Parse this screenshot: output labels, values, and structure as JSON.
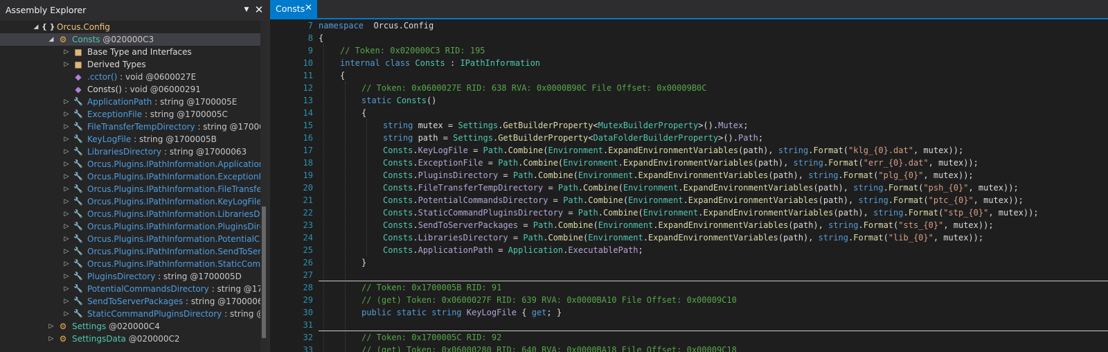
{
  "panel": {
    "title": "Assembly Explorer",
    "dropdown_icon": "chevron-down-icon",
    "close_icon": "close-icon"
  },
  "tree": [
    {
      "depth": 3,
      "expander": "expanded",
      "icon": "namespace-icon",
      "name": "Orcus.Config",
      "suffix": "",
      "kind": "namespace"
    },
    {
      "depth": 4,
      "expander": "expanded",
      "icon": "class-icon",
      "name": "Consts",
      "suffix": " @020000C3",
      "kind": "type",
      "selected": true
    },
    {
      "depth": 5,
      "expander": "collapsed",
      "icon": "folder-icon",
      "name": "Base Type and Interfaces",
      "suffix": "",
      "kind": "folder"
    },
    {
      "depth": 5,
      "expander": "collapsed",
      "icon": "folder-icon",
      "name": "Derived Types",
      "suffix": "",
      "kind": "folder"
    },
    {
      "depth": 5,
      "expander": "none",
      "icon": "method-icon",
      "name": ".cctor()",
      "suffix": " : void @0600027E",
      "kind": "member"
    },
    {
      "depth": 5,
      "expander": "none",
      "icon": "method-icon",
      "name": "Consts()",
      "suffix": " : void @06000291",
      "kind": "ctor"
    },
    {
      "depth": 5,
      "expander": "collapsed",
      "icon": "property-icon",
      "name": "ApplicationPath",
      "suffix": " : string @1700005E",
      "kind": "member"
    },
    {
      "depth": 5,
      "expander": "collapsed",
      "icon": "property-icon",
      "name": "ExceptionFile",
      "suffix": " : string @1700005C",
      "kind": "member"
    },
    {
      "depth": 5,
      "expander": "collapsed",
      "icon": "property-icon",
      "name": "FileTransferTempDirectory",
      "suffix": " : string @17000",
      "kind": "member"
    },
    {
      "depth": 5,
      "expander": "collapsed",
      "icon": "property-icon",
      "name": "KeyLogFile",
      "suffix": " : string @1700005B",
      "kind": "member"
    },
    {
      "depth": 5,
      "expander": "collapsed",
      "icon": "property-icon",
      "name": "LibrariesDirectory",
      "suffix": " : string @17000063",
      "kind": "member"
    },
    {
      "depth": 5,
      "expander": "collapsed",
      "icon": "property-icon",
      "name": "Orcus.Plugins.IPathInformation.Application",
      "suffix": "",
      "kind": "member"
    },
    {
      "depth": 5,
      "expander": "collapsed",
      "icon": "property-icon",
      "name": "Orcus.Plugins.IPathInformation.ExceptionF",
      "suffix": "",
      "kind": "member"
    },
    {
      "depth": 5,
      "expander": "collapsed",
      "icon": "property-icon",
      "name": "Orcus.Plugins.IPathInformation.FileTransfe",
      "suffix": "",
      "kind": "member"
    },
    {
      "depth": 5,
      "expander": "collapsed",
      "icon": "property-icon",
      "name": "Orcus.Plugins.IPathInformation.KeyLogFile",
      "suffix": "",
      "kind": "member"
    },
    {
      "depth": 5,
      "expander": "collapsed",
      "icon": "property-icon",
      "name": "Orcus.Plugins.IPathInformation.LibrariesDi",
      "suffix": "",
      "kind": "member"
    },
    {
      "depth": 5,
      "expander": "collapsed",
      "icon": "property-icon",
      "name": "Orcus.Plugins.IPathInformation.PluginsDire",
      "suffix": "",
      "kind": "member"
    },
    {
      "depth": 5,
      "expander": "collapsed",
      "icon": "property-icon",
      "name": "Orcus.Plugins.IPathInformation.PotentialCo",
      "suffix": "",
      "kind": "member"
    },
    {
      "depth": 5,
      "expander": "collapsed",
      "icon": "property-icon",
      "name": "Orcus.Plugins.IPathInformation.SendToSer",
      "suffix": "",
      "kind": "member"
    },
    {
      "depth": 5,
      "expander": "collapsed",
      "icon": "property-icon",
      "name": "Orcus.Plugins.IPathInformation.StaticComr",
      "suffix": "",
      "kind": "member"
    },
    {
      "depth": 5,
      "expander": "collapsed",
      "icon": "property-icon",
      "name": "PluginsDirectory",
      "suffix": " : string @1700005D",
      "kind": "member"
    },
    {
      "depth": 5,
      "expander": "collapsed",
      "icon": "property-icon",
      "name": "PotentialCommandsDirectory",
      "suffix": " : string @17",
      "kind": "member"
    },
    {
      "depth": 5,
      "expander": "collapsed",
      "icon": "property-icon",
      "name": "SendToServerPackages",
      "suffix": " : string @1700006",
      "kind": "member"
    },
    {
      "depth": 5,
      "expander": "collapsed",
      "icon": "property-icon",
      "name": "StaticCommandPluginsDirectory",
      "suffix": " : string @",
      "kind": "member"
    },
    {
      "depth": 4,
      "expander": "collapsed",
      "icon": "class-icon",
      "name": "Settings",
      "suffix": " @020000C4",
      "kind": "type"
    },
    {
      "depth": 4,
      "expander": "collapsed",
      "icon": "class-icon",
      "name": "SettingsData",
      "suffix": " @020000C2",
      "kind": "type"
    }
  ],
  "editor": {
    "tab_label": "Consts",
    "tab_close_icon": "close-icon"
  },
  "code_lines": [
    {
      "n": "7",
      "indent": 0,
      "tokens": [
        [
          "kw",
          "namespace"
        ],
        [
          "",
          "  "
        ],
        [
          "",
          "Orcus.Config"
        ]
      ]
    },
    {
      "n": "8",
      "indent": 0,
      "tokens": [
        [
          "",
          "{"
        ]
      ]
    },
    {
      "n": "9",
      "indent": 1,
      "tokens": [
        [
          "cm",
          "// Token: 0x020000C3 RID: 195"
        ]
      ]
    },
    {
      "n": "10",
      "indent": 1,
      "tokens": [
        [
          "kw",
          "internal"
        ],
        [
          "",
          " "
        ],
        [
          "kw",
          "class"
        ],
        [
          "",
          " "
        ],
        [
          "ty",
          "Consts"
        ],
        [
          "",
          " : "
        ],
        [
          "ty",
          "IPathInformation"
        ]
      ]
    },
    {
      "n": "11",
      "indent": 1,
      "tokens": [
        [
          "",
          "{"
        ]
      ]
    },
    {
      "n": "12",
      "indent": 2,
      "tokens": [
        [
          "cm",
          "// Token: 0x0600027E RID: 638 RVA: 0x0000B90C File Offset: 0x00009B0C"
        ]
      ]
    },
    {
      "n": "13",
      "indent": 2,
      "tokens": [
        [
          "kw",
          "static"
        ],
        [
          "",
          " "
        ],
        [
          "ty",
          "Consts"
        ],
        [
          "",
          "()"
        ]
      ]
    },
    {
      "n": "14",
      "indent": 2,
      "tokens": [
        [
          "",
          "{"
        ]
      ]
    },
    {
      "n": "15",
      "indent": 3,
      "tokens": [
        [
          "kw",
          "string"
        ],
        [
          "",
          " mutex = "
        ],
        [
          "ty",
          "Settings"
        ],
        [
          "",
          "."
        ],
        [
          "me",
          "GetBuilderProperty"
        ],
        [
          "",
          "<"
        ],
        [
          "ty",
          "MutexBuilderProperty"
        ],
        [
          "",
          ">()."
        ],
        [
          "mp",
          "Mutex"
        ],
        [
          "",
          ";"
        ]
      ]
    },
    {
      "n": "16",
      "indent": 3,
      "tokens": [
        [
          "kw",
          "string"
        ],
        [
          "",
          " path = "
        ],
        [
          "ty",
          "Settings"
        ],
        [
          "",
          "."
        ],
        [
          "me",
          "GetBuilderProperty"
        ],
        [
          "",
          "<"
        ],
        [
          "ty",
          "DataFolderBuilderProperty"
        ],
        [
          "",
          ">()."
        ],
        [
          "mp",
          "Path"
        ],
        [
          "",
          ";"
        ]
      ]
    },
    {
      "n": "17",
      "indent": 3,
      "tokens": [
        [
          "ty",
          "Consts"
        ],
        [
          "",
          "."
        ],
        [
          "mp",
          "KeyLogFile"
        ],
        [
          "",
          " = "
        ],
        [
          "ty",
          "Path"
        ],
        [
          "",
          "."
        ],
        [
          "me",
          "Combine"
        ],
        [
          "",
          "("
        ],
        [
          "ty",
          "Environment"
        ],
        [
          "",
          "."
        ],
        [
          "me",
          "ExpandEnvironmentVariables"
        ],
        [
          "",
          "(path), "
        ],
        [
          "kw",
          "string"
        ],
        [
          "",
          "."
        ],
        [
          "me",
          "Format"
        ],
        [
          "",
          "("
        ],
        [
          "st",
          "\"klg_{0}.dat\""
        ],
        [
          "",
          ", mutex));"
        ]
      ]
    },
    {
      "n": "18",
      "indent": 3,
      "tokens": [
        [
          "ty",
          "Consts"
        ],
        [
          "",
          "."
        ],
        [
          "mp",
          "ExceptionFile"
        ],
        [
          "",
          " = "
        ],
        [
          "ty",
          "Path"
        ],
        [
          "",
          "."
        ],
        [
          "me",
          "Combine"
        ],
        [
          "",
          "("
        ],
        [
          "ty",
          "Environment"
        ],
        [
          "",
          "."
        ],
        [
          "me",
          "ExpandEnvironmentVariables"
        ],
        [
          "",
          "(path), "
        ],
        [
          "kw",
          "string"
        ],
        [
          "",
          "."
        ],
        [
          "me",
          "Format"
        ],
        [
          "",
          "("
        ],
        [
          "st",
          "\"err_{0}.dat\""
        ],
        [
          "",
          ", mutex));"
        ]
      ]
    },
    {
      "n": "19",
      "indent": 3,
      "tokens": [
        [
          "ty",
          "Consts"
        ],
        [
          "",
          "."
        ],
        [
          "mp",
          "PluginsDirectory"
        ],
        [
          "",
          " = "
        ],
        [
          "ty",
          "Path"
        ],
        [
          "",
          "."
        ],
        [
          "me",
          "Combine"
        ],
        [
          "",
          "("
        ],
        [
          "ty",
          "Environment"
        ],
        [
          "",
          "."
        ],
        [
          "me",
          "ExpandEnvironmentVariables"
        ],
        [
          "",
          "(path), "
        ],
        [
          "kw",
          "string"
        ],
        [
          "",
          "."
        ],
        [
          "me",
          "Format"
        ],
        [
          "",
          "("
        ],
        [
          "st",
          "\"plg_{0}\""
        ],
        [
          "",
          ", mutex));"
        ]
      ]
    },
    {
      "n": "20",
      "indent": 3,
      "tokens": [
        [
          "ty",
          "Consts"
        ],
        [
          "",
          "."
        ],
        [
          "mp",
          "FileTransferTempDirectory"
        ],
        [
          "",
          " = "
        ],
        [
          "ty",
          "Path"
        ],
        [
          "",
          "."
        ],
        [
          "me",
          "Combine"
        ],
        [
          "",
          "("
        ],
        [
          "ty",
          "Environment"
        ],
        [
          "",
          "."
        ],
        [
          "me",
          "ExpandEnvironmentVariables"
        ],
        [
          "",
          "(path), "
        ],
        [
          "kw",
          "string"
        ],
        [
          "",
          "."
        ],
        [
          "me",
          "Format"
        ],
        [
          "",
          "("
        ],
        [
          "st",
          "\"psh_{0}\""
        ],
        [
          "",
          ", mutex));"
        ]
      ]
    },
    {
      "n": "21",
      "indent": 3,
      "tokens": [
        [
          "ty",
          "Consts"
        ],
        [
          "",
          "."
        ],
        [
          "mp",
          "PotentialCommandsDirectory"
        ],
        [
          "",
          " = "
        ],
        [
          "ty",
          "Path"
        ],
        [
          "",
          "."
        ],
        [
          "me",
          "Combine"
        ],
        [
          "",
          "("
        ],
        [
          "ty",
          "Environment"
        ],
        [
          "",
          "."
        ],
        [
          "me",
          "ExpandEnvironmentVariables"
        ],
        [
          "",
          "(path), "
        ],
        [
          "kw",
          "string"
        ],
        [
          "",
          "."
        ],
        [
          "me",
          "Format"
        ],
        [
          "",
          "("
        ],
        [
          "st",
          "\"ptc_{0}\""
        ],
        [
          "",
          ", mutex));"
        ]
      ]
    },
    {
      "n": "22",
      "indent": 3,
      "tokens": [
        [
          "ty",
          "Consts"
        ],
        [
          "",
          "."
        ],
        [
          "mp",
          "StaticCommandPluginsDirectory"
        ],
        [
          "",
          " = "
        ],
        [
          "ty",
          "Path"
        ],
        [
          "",
          "."
        ],
        [
          "me",
          "Combine"
        ],
        [
          "",
          "("
        ],
        [
          "ty",
          "Environment"
        ],
        [
          "",
          "."
        ],
        [
          "me",
          "ExpandEnvironmentVariables"
        ],
        [
          "",
          "(path), "
        ],
        [
          "kw",
          "string"
        ],
        [
          "",
          "."
        ],
        [
          "me",
          "Format"
        ],
        [
          "",
          "("
        ],
        [
          "st",
          "\"stp_{0}\""
        ],
        [
          "",
          ", mutex));"
        ]
      ]
    },
    {
      "n": "23",
      "indent": 3,
      "tokens": [
        [
          "ty",
          "Consts"
        ],
        [
          "",
          "."
        ],
        [
          "mp",
          "SendToServerPackages"
        ],
        [
          "",
          " = "
        ],
        [
          "ty",
          "Path"
        ],
        [
          "",
          "."
        ],
        [
          "me",
          "Combine"
        ],
        [
          "",
          "("
        ],
        [
          "ty",
          "Environment"
        ],
        [
          "",
          "."
        ],
        [
          "me",
          "ExpandEnvironmentVariables"
        ],
        [
          "",
          "(path), "
        ],
        [
          "kw",
          "string"
        ],
        [
          "",
          "."
        ],
        [
          "me",
          "Format"
        ],
        [
          "",
          "("
        ],
        [
          "st",
          "\"sts_{0}\""
        ],
        [
          "",
          ", mutex));"
        ]
      ]
    },
    {
      "n": "24",
      "indent": 3,
      "tokens": [
        [
          "ty",
          "Consts"
        ],
        [
          "",
          "."
        ],
        [
          "mp",
          "LibrariesDirectory"
        ],
        [
          "",
          " = "
        ],
        [
          "ty",
          "Path"
        ],
        [
          "",
          "."
        ],
        [
          "me",
          "Combine"
        ],
        [
          "",
          "("
        ],
        [
          "ty",
          "Environment"
        ],
        [
          "",
          "."
        ],
        [
          "me",
          "ExpandEnvironmentVariables"
        ],
        [
          "",
          "(path), "
        ],
        [
          "kw",
          "string"
        ],
        [
          "",
          "."
        ],
        [
          "me",
          "Format"
        ],
        [
          "",
          "("
        ],
        [
          "st",
          "\"lib_{0}\""
        ],
        [
          "",
          ", mutex));"
        ]
      ]
    },
    {
      "n": "25",
      "indent": 3,
      "tokens": [
        [
          "ty",
          "Consts"
        ],
        [
          "",
          "."
        ],
        [
          "mp",
          "ApplicationPath"
        ],
        [
          "",
          " = "
        ],
        [
          "ty",
          "Application"
        ],
        [
          "",
          "."
        ],
        [
          "mp",
          "ExecutablePath"
        ],
        [
          "",
          ";"
        ]
      ]
    },
    {
      "n": "26",
      "indent": 2,
      "tokens": [
        [
          "",
          "}"
        ]
      ]
    },
    {
      "n": "27",
      "indent": 0,
      "tokens": []
    },
    {
      "n": "28",
      "indent": 2,
      "tokens": [
        [
          "cm",
          "// Token: 0x1700005B RID: 91"
        ]
      ]
    },
    {
      "n": "29",
      "indent": 2,
      "tokens": [
        [
          "cm",
          "// (get) Token: 0x0600027F RID: 639 RVA: 0x0000BA10 File Offset: 0x00009C10"
        ]
      ]
    },
    {
      "n": "30",
      "indent": 2,
      "tokens": [
        [
          "kw",
          "public"
        ],
        [
          "",
          " "
        ],
        [
          "kw",
          "static"
        ],
        [
          "",
          " "
        ],
        [
          "kw",
          "string"
        ],
        [
          "",
          " "
        ],
        [
          "mp",
          "KeyLogFile"
        ],
        [
          "",
          " { "
        ],
        [
          "kw",
          "get"
        ],
        [
          "",
          "; }"
        ]
      ]
    },
    {
      "n": "31",
      "indent": 0,
      "tokens": []
    },
    {
      "n": "32",
      "indent": 2,
      "tokens": [
        [
          "cm",
          "// Token: 0x1700005C RID: 92"
        ]
      ]
    },
    {
      "n": "33",
      "indent": 2,
      "tokens": [
        [
          "cm",
          "// (get) Token: 0x06000280 RID: 640 RVA: 0x0000BA18 File Offset: 0x00009C18"
        ]
      ]
    }
  ]
}
